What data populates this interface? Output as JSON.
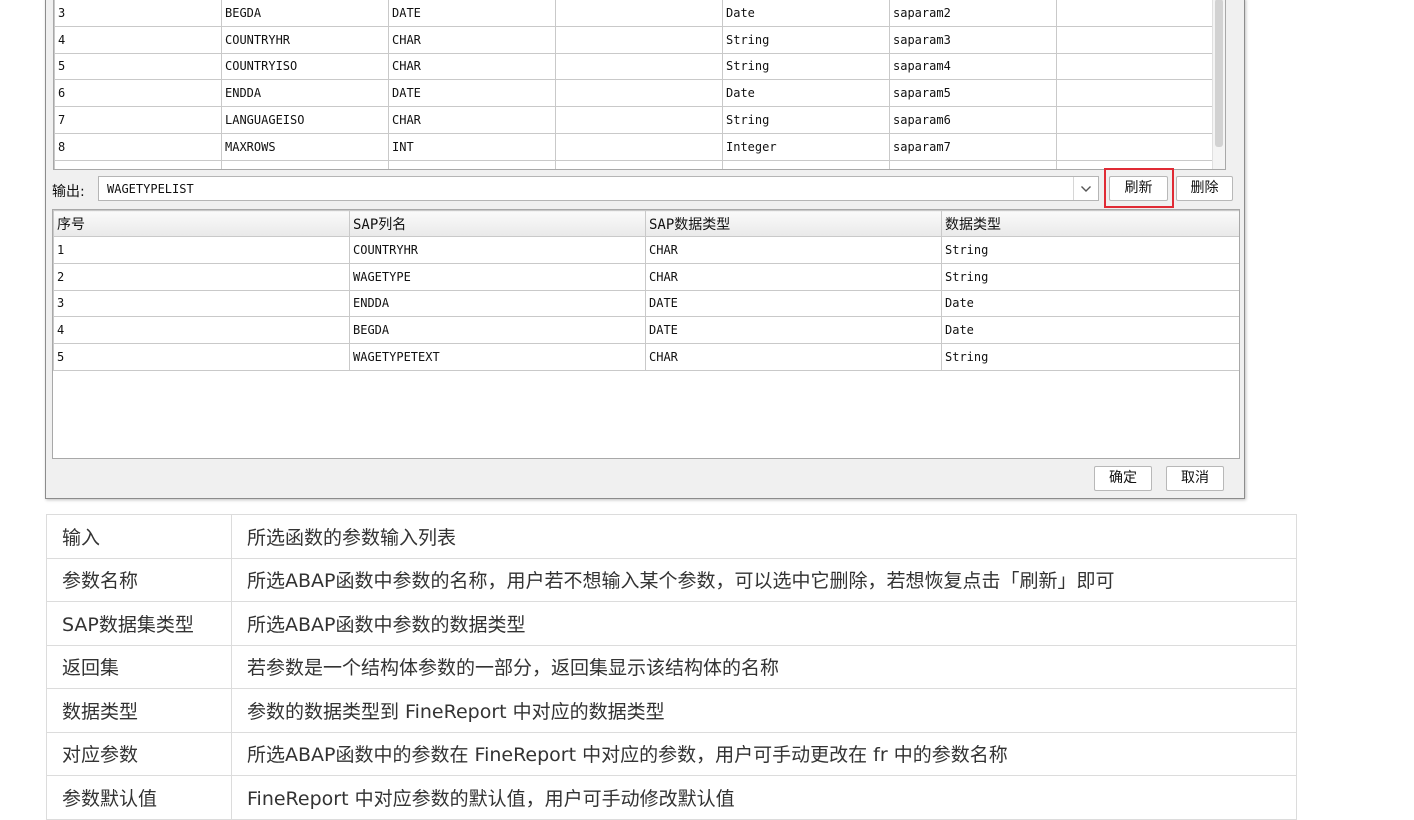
{
  "input_table": {
    "rows": [
      [
        "3",
        "BEGDA",
        "DATE",
        "",
        "Date",
        "saparam2",
        ""
      ],
      [
        "4",
        "COUNTRYHR",
        "CHAR",
        "",
        "String",
        "saparam3",
        ""
      ],
      [
        "5",
        "COUNTRYISO",
        "CHAR",
        "",
        "String",
        "saparam4",
        ""
      ],
      [
        "6",
        "ENDDA",
        "DATE",
        "",
        "Date",
        "saparam5",
        ""
      ],
      [
        "7",
        "LANGUAGEISO",
        "CHAR",
        "",
        "String",
        "saparam6",
        ""
      ],
      [
        "8",
        "MAXROWS",
        "INT",
        "",
        "Integer",
        "saparam7",
        ""
      ]
    ]
  },
  "output": {
    "label": "输出:",
    "selected": "WAGETYPELIST",
    "refresh_label": "刷新",
    "delete_label": "删除"
  },
  "output_table": {
    "headers": [
      "序号",
      "SAP列名",
      "SAP数据类型",
      "数据类型"
    ],
    "rows": [
      [
        "1",
        "COUNTRYHR",
        "CHAR",
        "String"
      ],
      [
        "2",
        "WAGETYPE",
        "CHAR",
        "String"
      ],
      [
        "3",
        "ENDDA",
        "DATE",
        "Date"
      ],
      [
        "4",
        "BEGDA",
        "DATE",
        "Date"
      ],
      [
        "5",
        "WAGETYPETEXT",
        "CHAR",
        "String"
      ]
    ]
  },
  "dialog_buttons": {
    "ok_label": "确定",
    "cancel_label": "取消"
  },
  "description_table": {
    "rows": [
      [
        "输入",
        "所选函数的参数输入列表"
      ],
      [
        "参数名称",
        "所选ABAP函数中参数的名称，用户若不想输入某个参数，可以选中它删除，若想恢复点击「刷新」即可"
      ],
      [
        "SAP数据集类型",
        "所选ABAP函数中参数的数据类型"
      ],
      [
        "返回集",
        "若参数是一个结构体参数的一部分，返回集显示该结构体的名称"
      ],
      [
        "数据类型",
        "参数的数据类型到 FineReport 中对应的数据类型"
      ],
      [
        "对应参数",
        "所选ABAP函数中的参数在 FineReport 中对应的参数，用户可手动更改在 fr 中的参数名称"
      ],
      [
        "参数默认值",
        "FineReport 中对应参数的默认值，用户可手动修改默认值"
      ]
    ]
  },
  "colors": {
    "highlight": "#e02b35",
    "dialog_bg": "#f0f0f0"
  }
}
